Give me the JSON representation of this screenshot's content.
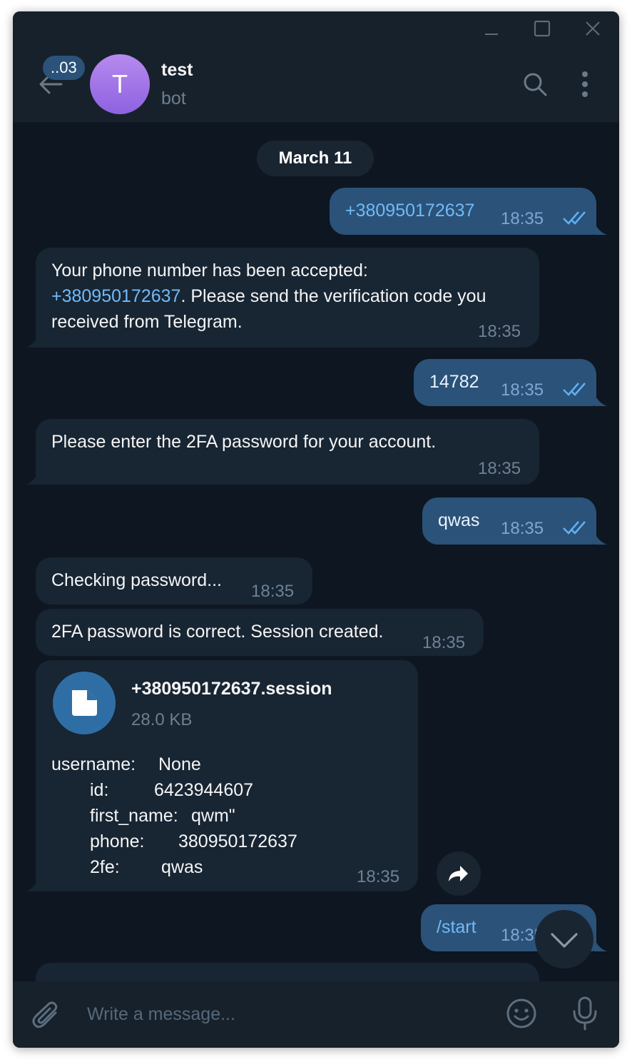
{
  "window": {
    "controls": [
      "minimize",
      "maximize",
      "close"
    ]
  },
  "header": {
    "unread_badge": "..03",
    "avatar_letter": "T",
    "title": "test",
    "subtitle": "bot",
    "icons": [
      "back-arrow-icon",
      "search-icon",
      "more-vertical-icon"
    ]
  },
  "date_separator": "March 11",
  "messages": [
    {
      "dir": "out",
      "text": "+380950172637",
      "time": "18:35"
    },
    {
      "dir": "in",
      "line1": "Your phone number has been accepted:",
      "line2_link": "+380950172637",
      "line2_rest": ". Please send the verification code you",
      "line3": "received from Telegram.",
      "time": "18:35"
    },
    {
      "dir": "out",
      "text": "14782",
      "time": "18:35"
    },
    {
      "dir": "in",
      "text": "Please enter the 2FA password for your account.",
      "time": "18:35"
    },
    {
      "dir": "out",
      "text": "qwas",
      "time": "18:35"
    },
    {
      "dir": "in",
      "text": "Checking password...",
      "time": "18:35"
    },
    {
      "dir": "in",
      "text": "2FA password is correct. Session created.",
      "time": "18:35"
    },
    {
      "dir": "in",
      "file_name": "+380950172637.session",
      "file_size": "28.0 KB",
      "details": [
        {
          "key": "username:",
          "value": "None"
        },
        {
          "key": "id:",
          "value": "6423944607"
        },
        {
          "key": "first_name:",
          "value": "qwm\""
        },
        {
          "key": "phone:",
          "value": "380950172637"
        },
        {
          "key": "2fe:",
          "value": "qwas"
        }
      ],
      "time": "18:35"
    },
    {
      "dir": "out",
      "text": "/start",
      "time": "18:35"
    }
  ],
  "composer": {
    "placeholder": "Write a message..."
  },
  "colors": {
    "window_bg": "#0e1621",
    "header_bg": "#17212b",
    "outgoing_bubble": "#2b5278",
    "incoming_bubble": "#182533",
    "link": "#71baf8",
    "avatar": "#9b6fe6"
  }
}
